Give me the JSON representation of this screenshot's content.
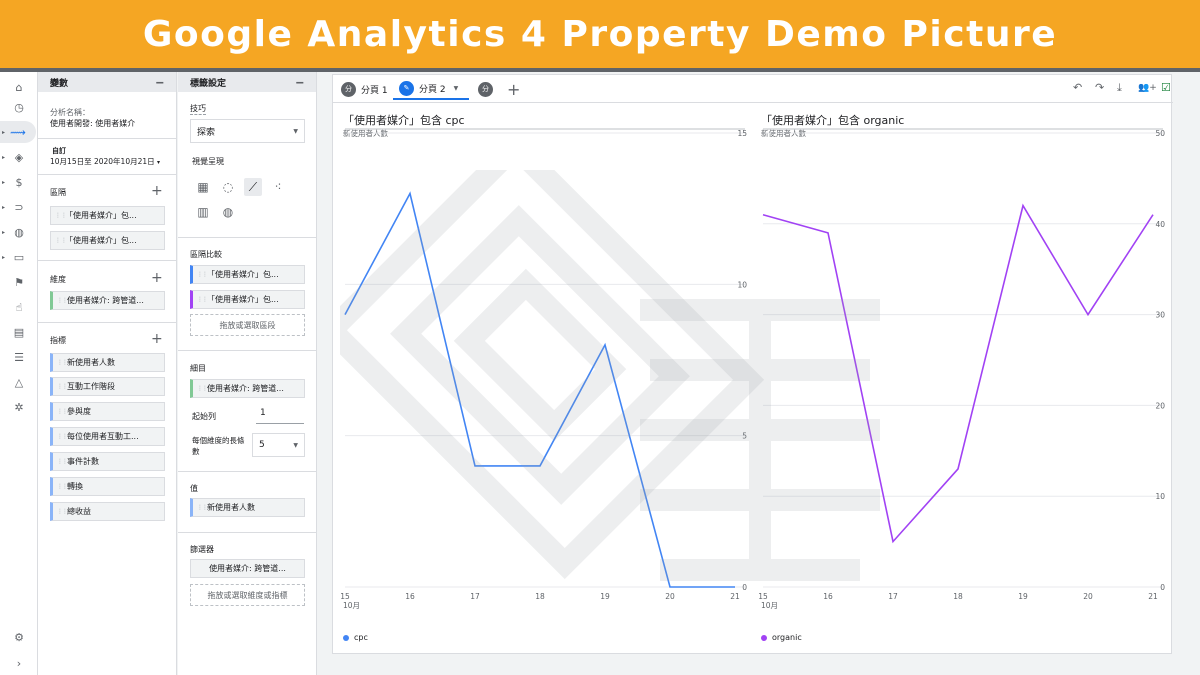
{
  "banner": {
    "title": "Google Analytics 4 Property Demo Picture"
  },
  "colors": {
    "banner": "#f5a623",
    "cpc": "#4285f4",
    "organic": "#a142f4",
    "accent": "#1a73e8"
  },
  "rail": {
    "items": [
      {
        "icon": "home-icon"
      },
      {
        "icon": "clock-icon"
      },
      {
        "icon": "explore-icon",
        "active": true
      },
      {
        "icon": "tag-icon"
      },
      {
        "icon": "dollar-icon"
      },
      {
        "icon": "magnet-icon"
      },
      {
        "icon": "globe-icon"
      },
      {
        "icon": "devices-icon"
      },
      {
        "icon": "flag-icon"
      },
      {
        "icon": "touch-icon"
      },
      {
        "icon": "report-icon"
      },
      {
        "icon": "user-list-icon"
      },
      {
        "icon": "shapes-icon"
      },
      {
        "icon": "debug-icon"
      }
    ]
  },
  "variables": {
    "header": "變數",
    "analysis_name_label": "分析名稱：",
    "analysis_name": "使用者開發: 使用者媒介",
    "date_label": "自訂",
    "date_range": "10月15日至 2020年10月21日",
    "segments_label": "區隔",
    "segments": [
      "「使用者媒介」包...",
      "「使用者媒介」包..."
    ],
    "dimensions_label": "維度",
    "dimensions": [
      "使用者媒介: 跨管道..."
    ],
    "metrics_label": "指標",
    "metrics": [
      "新使用者人數",
      "互動工作階段",
      "參與度",
      "每位使用者互動工...",
      "事件計數",
      "轉換",
      "總收益"
    ]
  },
  "tab_settings": {
    "header": "標籤設定",
    "technique_label": "技巧",
    "technique_value": "探索",
    "visualization_label": "視覺呈現",
    "viz_icons": [
      "table-icon",
      "donut-icon",
      "line-chart-icon",
      "scatter-icon",
      "bar-chart-icon",
      "geo-icon"
    ],
    "segment_compare_label": "區隔比較",
    "segment_compare": [
      "「使用者媒介」包...",
      "「使用者媒介」包..."
    ],
    "segment_drop": "拖放或選取區段",
    "breakdown_label": "細目",
    "breakdown": "使用者媒介: 跨管道...",
    "start_row_label": "起始列",
    "start_row_value": "1",
    "rows_per_dim_label_1": "每個維度的長條",
    "rows_per_dim_label_2": "數",
    "rows_per_dim_value": "5",
    "values_label": "值",
    "values": "新使用者人數",
    "filters_label": "篩選器",
    "filters": "使用者媒介: 跨管道...",
    "filters_drop": "拖放或選取維度或指標"
  },
  "tabs": [
    {
      "badge": "分",
      "label": "分頁 1"
    },
    {
      "badge": "✎",
      "label": "分頁 2",
      "active": true
    },
    {
      "badge": "分",
      "label": ""
    }
  ],
  "toolbar_icons": [
    "undo-icon",
    "redo-icon",
    "download-icon",
    "share-icon",
    "check-icon"
  ],
  "chart_data": [
    {
      "type": "line",
      "title": "「使用者媒介」包含 cpc",
      "ylabel": "新使用者人數",
      "x": [
        "15",
        "16",
        "17",
        "18",
        "19",
        "20",
        "21"
      ],
      "x_month_label": "10月",
      "series": [
        {
          "name": "cpc",
          "values": [
            9,
            13,
            4,
            4,
            8,
            0,
            0
          ]
        }
      ],
      "ylim": [
        0,
        15
      ],
      "yticks": [
        0,
        5,
        10,
        15
      ],
      "grid": true,
      "legend": "bottom-left"
    },
    {
      "type": "line",
      "title": "「使用者媒介」包含 organic",
      "ylabel": "新使用者人數",
      "x": [
        "15",
        "16",
        "17",
        "18",
        "19",
        "20",
        "21"
      ],
      "x_month_label": "10月",
      "series": [
        {
          "name": "organic",
          "values": [
            41,
            39,
            5,
            13,
            42,
            30,
            41
          ]
        }
      ],
      "ylim": [
        0,
        50
      ],
      "yticks": [
        0,
        10,
        20,
        30,
        40,
        50
      ],
      "grid": true,
      "legend": "bottom-left"
    }
  ]
}
